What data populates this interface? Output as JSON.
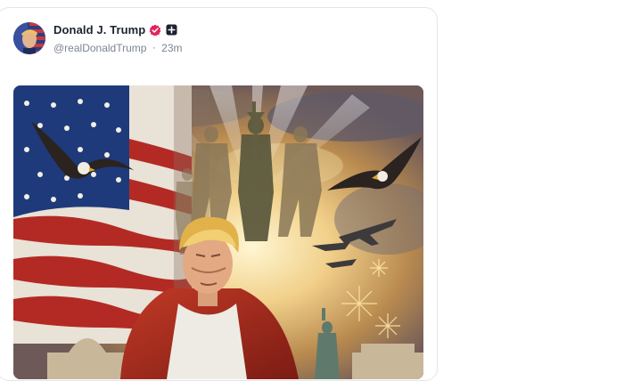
{
  "post": {
    "author": {
      "display_name": "Donald J. Trump",
      "handle": "@realDonaldTrump",
      "verified": true,
      "badge_icon": "verified-check-icon",
      "extra_icon": "plus-square-icon"
    },
    "separator": "·",
    "timestamp": "23m",
    "media": {
      "type": "image",
      "icon": "painting-image"
    }
  },
  "colors": {
    "verified_badge": "#e0245e",
    "name_text": "#1d2230",
    "meta_text": "#7c8593",
    "card_border": "#e3e5e8"
  }
}
